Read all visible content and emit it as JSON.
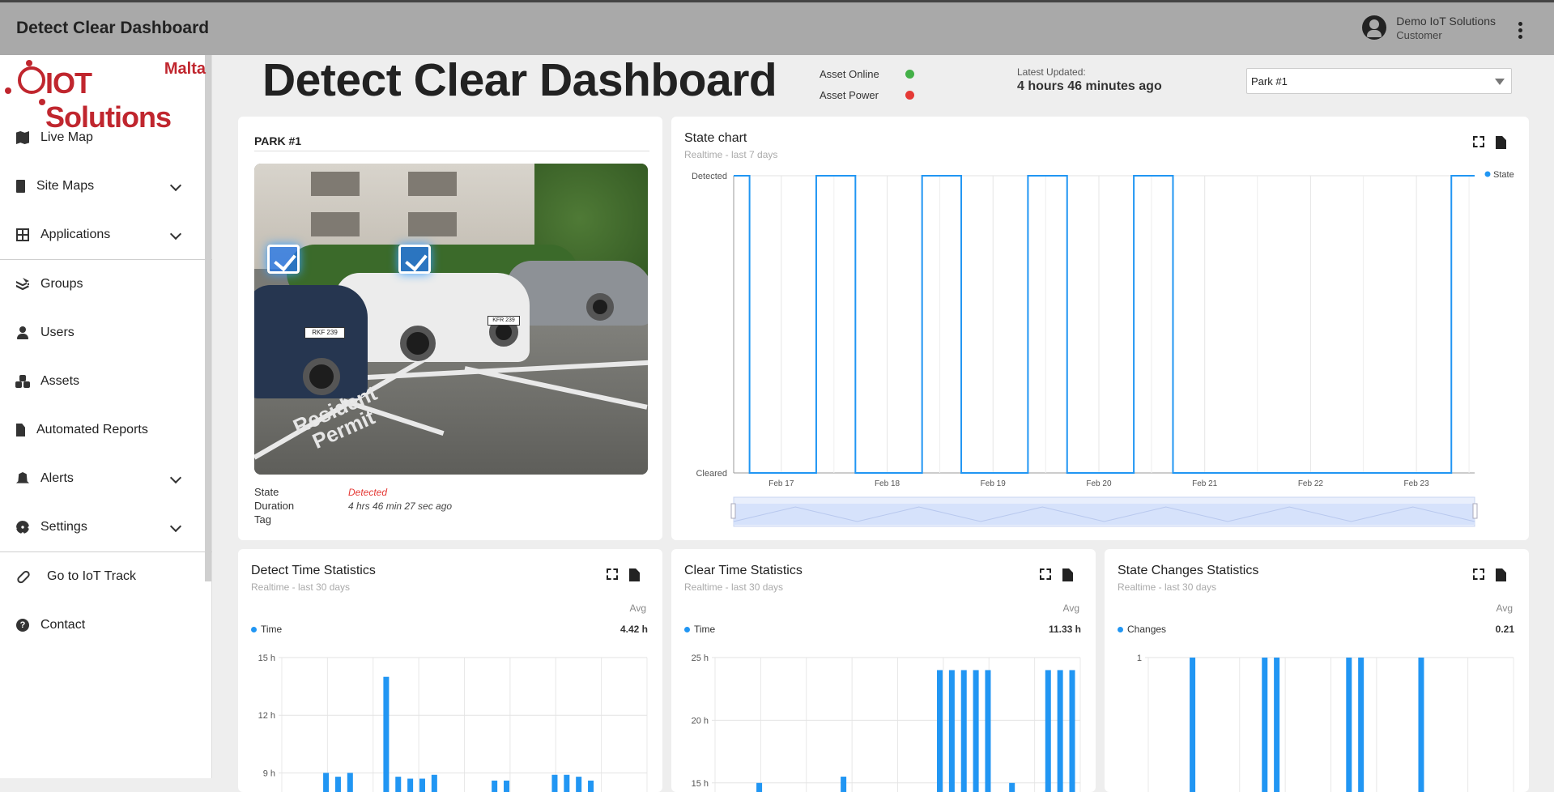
{
  "topbar": {
    "title": "Detect Clear Dashboard",
    "user_name": "Demo IoT Solutions",
    "user_role": "Customer"
  },
  "logo": {
    "brand": "IOT Solutions",
    "region": "Malta"
  },
  "sidebar": {
    "items": [
      {
        "label": "Live Map",
        "icon": "map-icon"
      },
      {
        "label": "Site Maps",
        "icon": "building-icon",
        "expandable": true
      },
      {
        "label": "Applications",
        "icon": "grid-icon",
        "expandable": true
      },
      {
        "label": "Groups",
        "icon": "layers-icon"
      },
      {
        "label": "Users",
        "icon": "user-icon"
      },
      {
        "label": "Assets",
        "icon": "cubes-icon"
      },
      {
        "label": "Automated Reports",
        "icon": "file-icon"
      },
      {
        "label": "Alerts",
        "icon": "bell-icon",
        "expandable": true
      },
      {
        "label": "Settings",
        "icon": "gear-icon",
        "expandable": true
      },
      {
        "label": "Go to IoT Track",
        "icon": "link-icon"
      },
      {
        "label": "Contact",
        "icon": "help-icon"
      }
    ]
  },
  "header": {
    "title": "Detect Clear Dashboard",
    "asset_online_label": "Asset Online",
    "asset_power_label": "Asset Power",
    "asset_online_color": "#43b047",
    "asset_power_color": "#e53935",
    "latest_label": "Latest Updated:",
    "latest_value": "4 hours 46 minutes ago",
    "park_select": "Park #1"
  },
  "park_card": {
    "title": "PARK #1",
    "state_label": "State",
    "state_value": "Detected",
    "duration_label": "Duration",
    "duration_value": "4 hrs 46 min 27 sec ago",
    "tag_label": "Tag",
    "plate_1": "RKF 239",
    "plate_2": "KFR 239",
    "paint_1": "Resident",
    "paint_2": "Permit"
  },
  "state_card": {
    "title": "State chart",
    "subtitle": "Realtime - last 7 days"
  },
  "detect_card": {
    "title": "Detect Time Statistics",
    "subtitle": "Realtime - last 30 days",
    "avg_label": "Avg",
    "legend": "Time",
    "avg_value": "4.42 h"
  },
  "clear_card": {
    "title": "Clear Time Statistics",
    "subtitle": "Realtime - last 30 days",
    "avg_label": "Avg",
    "legend": "Time",
    "avg_value": "11.33 h"
  },
  "changes_card": {
    "title": "State Changes Statistics",
    "subtitle": "Realtime - last 30 days",
    "avg_label": "Avg",
    "legend": "Changes",
    "avg_value": "0.21"
  },
  "chart_data": [
    {
      "type": "line",
      "title": "State chart",
      "series": [
        {
          "name": "State",
          "color": "#2196f3",
          "points": [
            [
              16.55,
              1
            ],
            [
              16.7,
              1
            ],
            [
              16.7,
              0
            ],
            [
              17.33,
              0
            ],
            [
              17.33,
              1
            ],
            [
              17.7,
              1
            ],
            [
              17.7,
              0
            ],
            [
              18.33,
              0
            ],
            [
              18.33,
              1
            ],
            [
              18.7,
              1
            ],
            [
              18.7,
              0
            ],
            [
              19.33,
              0
            ],
            [
              19.33,
              1
            ],
            [
              19.7,
              1
            ],
            [
              19.7,
              0
            ],
            [
              20.33,
              0
            ],
            [
              20.33,
              1
            ],
            [
              20.7,
              1
            ],
            [
              20.7,
              0
            ],
            [
              23.33,
              0
            ],
            [
              23.33,
              1
            ],
            [
              23.55,
              1
            ]
          ]
        }
      ],
      "x_ticks": [
        "Feb 17",
        "Feb 18",
        "Feb 19",
        "Feb 20",
        "Feb 21",
        "Feb 22",
        "Feb 23"
      ],
      "x_tick_values": [
        17,
        18,
        19,
        20,
        21,
        22,
        23
      ],
      "xlim": [
        16.55,
        23.55
      ],
      "y_ticks": [
        "Cleared",
        "Detected"
      ],
      "ylim": [
        0,
        1
      ],
      "legend_position": "top-right"
    },
    {
      "type": "bar",
      "title": "Detect Time Statistics",
      "series": [
        {
          "name": "Time",
          "color": "#2196f3",
          "values": [
            0,
            0,
            0,
            9.0,
            8.8,
            9.0,
            0,
            0,
            14.0,
            8.8,
            8.7,
            8.7,
            8.9,
            0,
            0,
            0,
            0,
            8.6,
            8.6,
            0,
            0,
            0,
            8.9,
            8.9,
            8.8,
            8.6,
            0,
            0,
            0,
            0
          ]
        }
      ],
      "y_ticks": [
        "9 h",
        "12 h",
        "15 h"
      ],
      "ylim": [
        7.5,
        15
      ]
    },
    {
      "type": "bar",
      "title": "Clear Time Statistics",
      "series": [
        {
          "name": "Time",
          "color": "#2196f3",
          "values": [
            0,
            0,
            0,
            15.0,
            0,
            0,
            0,
            0,
            0,
            0,
            15.5,
            0,
            0,
            0,
            0,
            0,
            0,
            0,
            24.0,
            24.0,
            24.0,
            24.0,
            24.0,
            0,
            15.0,
            0,
            0,
            24.0,
            24.0,
            24.0
          ]
        }
      ],
      "y_ticks": [
        "15 h",
        "20 h",
        "25 h"
      ],
      "ylim": [
        13.5,
        25
      ]
    },
    {
      "type": "bar",
      "title": "State Changes Statistics",
      "series": [
        {
          "name": "Changes",
          "color": "#2196f3",
          "values": [
            0,
            0,
            0,
            1,
            0,
            0,
            0,
            0,
            0,
            1,
            1,
            0,
            0,
            0,
            0,
            0,
            1,
            1,
            0,
            0,
            0,
            0,
            1,
            0,
            0,
            0,
            0,
            0,
            0,
            0
          ]
        }
      ],
      "y_ticks": [
        "1"
      ],
      "ylim": [
        0,
        1
      ]
    }
  ]
}
